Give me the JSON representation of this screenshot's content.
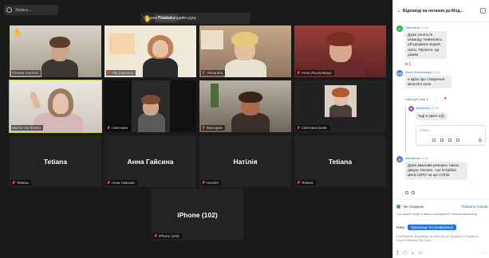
{
  "topbar": {
    "meeting_label": "Запись..."
  },
  "raise_banner": {
    "message": "Oksana Yurchuk поднял руку",
    "show_button": "Показать",
    "close": "×"
  },
  "tiles": [
    {
      "name": "Oksana Yurchuk"
    },
    {
      "name": "Alla Zaytseva"
    },
    {
      "name": "Alexandra"
    },
    {
      "name": "Anna Zhuravskaya"
    },
    {
      "name": "Marina Yurchenko"
    },
    {
      "name": "Светлана"
    },
    {
      "name": "Виктория"
    },
    {
      "name": "Светлана Баяв"
    },
    {
      "name": "Tetiana",
      "big": "Tetiana"
    },
    {
      "name": "Анна Гайсина",
      "big": "Анна Гайсина"
    },
    {
      "name": "Натілія",
      "big": "Натілія"
    },
    {
      "name": "Tetiana",
      "big": "Tetiana"
    },
    {
      "name": "iPhone (102)",
      "big": "iPhone (102)"
    }
  ],
  "chat": {
    "title": "Відповіді на питання до Мод...",
    "messages": [
      {
        "avatar": "С",
        "sender": "Светлана",
        "time": "12:29",
        "text": "Дуже хочеться команду. Навчились об'єднувати людей, сім'ю. Проекти. Це цікаво",
        "reaction": "♥ 1"
      },
      {
        "avatar": "AZ",
        "sender": "Anna Zhuravskaya",
        "time": "12:31",
        "text": "я мрію про створення жіночого кола",
        "reaction": "♥"
      },
      {
        "avatar": "A",
        "sender": "Alexandra",
        "time": "12:32",
        "text": "Дуже важлива ремарка також, дякую, Оксана - що потрібно мати СИЛУ на цю СОЛО"
      }
    ],
    "reply_hint": "Свернуть все ∨",
    "reply_sender": "Alexandra",
    "reply_time": "12:31",
    "reply_text": "тоді в оркестр))",
    "reply_placeholder": "Ответ...",
    "reply_reaction": "1"
  },
  "footer": {
    "saved_label": "Чат сохранен",
    "show_in_folder": "Показать в папке",
    "who_sees": "Кто может видеть ваши сообщения? Запись включена",
    "to_label": "Кому:",
    "to_value": "Організації зm конференції",
    "input_placeholder": "Сообщение Відповіді на питання до Модуля 6 Єднання. Zoom Meeting The Soul"
  },
  "colors": {
    "accent": "#1a73e8",
    "speaking": "#b6d840",
    "muted": "#e8413c",
    "hand": "#f2c230"
  }
}
